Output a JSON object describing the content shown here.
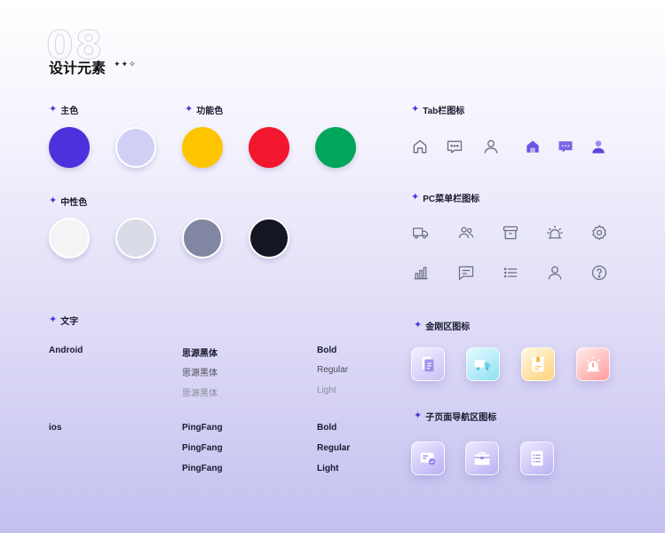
{
  "header": {
    "big_number": "08",
    "title": "设计元素",
    "sparkles": "✦✦✧"
  },
  "sections": {
    "primary_color": "主色",
    "functional_color": "功能色",
    "neutral_color": "中性色",
    "text": "文字",
    "tabbar_icons": "Tab栏图标",
    "pc_menu_icons": "PC菜单栏图标",
    "kingkong_icons": "金刚区图标",
    "subpage_nav_icons": "子页面导航区图标"
  },
  "colors": {
    "primary": [
      "#4B32DC",
      "#D2CFF7"
    ],
    "functional": [
      "#FFC400",
      "#F2162E",
      "#02A65A"
    ],
    "neutral": [
      "#F4F4F6",
      "#D9DBE6",
      "#8186A3",
      "#141623"
    ]
  },
  "typography": {
    "android": {
      "platform": "Android",
      "font": [
        "思源黑体",
        "思源黑体",
        "思源黑体"
      ],
      "weights": [
        "Bold",
        "Regular",
        "Light"
      ]
    },
    "ios": {
      "platform": "ios",
      "font": [
        "PingFang",
        "PingFang",
        "PingFang"
      ],
      "weights": [
        "Bold",
        "Regular",
        "Light"
      ]
    }
  },
  "icons": {
    "tab_outline": [
      "home-icon",
      "message-icon",
      "user-icon"
    ],
    "tab_filled": [
      "home-filled-icon",
      "message-filled-icon",
      "user-filled-icon"
    ],
    "pc_row1": [
      "truck-icon",
      "users-icon",
      "archive-icon",
      "alarm-icon",
      "settings-icon"
    ],
    "pc_row2": [
      "bar-chart-icon",
      "comment-icon",
      "list-icon",
      "user-icon",
      "help-icon"
    ],
    "kingkong": [
      "document-icon",
      "truck-icon",
      "book-icon",
      "alarm-icon"
    ],
    "subpage": [
      "card-check-icon",
      "briefcase-icon",
      "list-doc-icon"
    ]
  },
  "accent": "#4A36D6"
}
